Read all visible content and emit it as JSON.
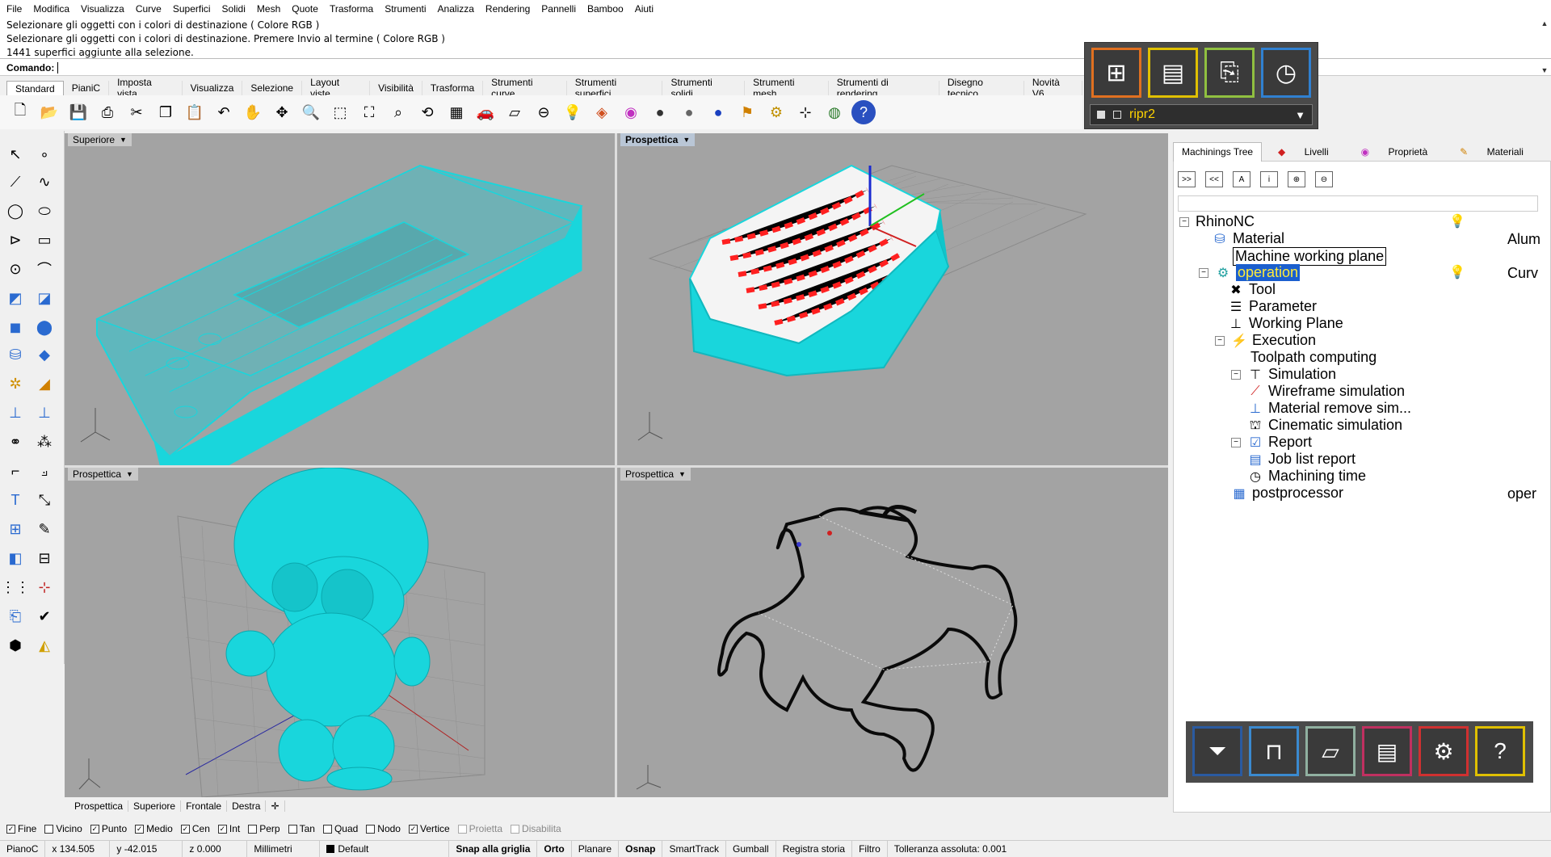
{
  "menu": [
    "File",
    "Modifica",
    "Visualizza",
    "Curve",
    "Superfici",
    "Solidi",
    "Mesh",
    "Quote",
    "Trasforma",
    "Strumenti",
    "Analizza",
    "Rendering",
    "Pannelli",
    "Bamboo",
    "Aiuti"
  ],
  "command_history": [
    "Selezionare gli oggetti con i colori di destinazione ( Colore  RGB )",
    "Selezionare gli oggetti con i colori di destinazione. Premere Invio al termine ( Colore  RGB )",
    "1441 superfici aggiunte alla selezione."
  ],
  "command_prompt": "Comando:",
  "toolbar_tabs": [
    "Standard",
    "PianiC",
    "Imposta vista",
    "Visualizza",
    "Selezione",
    "Layout viste",
    "Visibilità",
    "Trasforma",
    "Strumenti curve",
    "Strumenti superfici",
    "Strumenti solidi",
    "Strumenti mesh",
    "Strumenti di rendering",
    "Disegno tecnico",
    "Novità V6"
  ],
  "toolbar_icons": [
    "new-icon",
    "open-icon",
    "save-icon",
    "print-icon",
    "cut-icon",
    "copy-icon",
    "paste-icon",
    "undo-icon",
    "pan-icon",
    "rotate-icon",
    "zoom-icon",
    "zoom-window-icon",
    "zoom-extents-icon",
    "zoom-selected-icon",
    "rotate-view-icon",
    "grid-icon",
    "car-icon",
    "plane-icon",
    "snap-icon",
    "light-icon",
    "layer-icon",
    "color-icon",
    "sphere-shaded-icon",
    "sphere-render-icon",
    "sphere-blue-icon",
    "flag-icon",
    "gear-icon",
    "dimension-icon",
    "globe-icon",
    "help-icon"
  ],
  "nc_panel": {
    "selected": "ripr2",
    "buttons": [
      "new-operation",
      "machine",
      "import",
      "clock"
    ]
  },
  "viewports": {
    "top_left": "Superiore",
    "top_right": "Prospettica",
    "bottom_left": "Prospettica",
    "bottom_right": "Prospettica"
  },
  "viewport_tabs": [
    "Prospettica",
    "Superiore",
    "Frontale",
    "Destra"
  ],
  "right_panel": {
    "tabs": [
      "Machinings Tree",
      "Livelli",
      "Proprietà",
      "Materiali"
    ],
    "tree_buttons": [
      ">>",
      "<<",
      "A",
      "i",
      "zoom-in",
      "zoom-out"
    ],
    "tree": [
      {
        "label": "RhinoNC",
        "value": ""
      },
      {
        "label": "Material",
        "value": "Alum"
      },
      {
        "label": "Machine working plane",
        "value": ""
      },
      {
        "label": "operation",
        "value": "Curv"
      },
      {
        "label": "Tool",
        "value": ""
      },
      {
        "label": "Parameter",
        "value": ""
      },
      {
        "label": "Working Plane",
        "value": ""
      },
      {
        "label": "Execution",
        "value": ""
      },
      {
        "label": "Toolpath computing",
        "value": ""
      },
      {
        "label": "Simulation",
        "value": ""
      },
      {
        "label": "Wireframe simulation",
        "value": ""
      },
      {
        "label": "Material remove sim...",
        "value": ""
      },
      {
        "label": "Cinematic simulation",
        "value": ""
      },
      {
        "label": "Report",
        "value": ""
      },
      {
        "label": "Job list report",
        "value": ""
      },
      {
        "label": "Machining time",
        "value": ""
      },
      {
        "label": "postprocessor",
        "value": "oper"
      }
    ],
    "bottom_buttons": [
      "tool",
      "machine",
      "stock",
      "cabinet",
      "settings",
      "help"
    ]
  },
  "osnaps": [
    {
      "label": "Fine",
      "checked": true
    },
    {
      "label": "Vicino",
      "checked": false
    },
    {
      "label": "Punto",
      "checked": true
    },
    {
      "label": "Medio",
      "checked": true
    },
    {
      "label": "Cen",
      "checked": true
    },
    {
      "label": "Int",
      "checked": true
    },
    {
      "label": "Perp",
      "checked": false
    },
    {
      "label": "Tan",
      "checked": false
    },
    {
      "label": "Quad",
      "checked": false
    },
    {
      "label": "Nodo",
      "checked": false
    },
    {
      "label": "Vertice",
      "checked": true
    },
    {
      "label": "Proietta",
      "checked": false,
      "disabled": true
    },
    {
      "label": "Disabilita",
      "checked": false,
      "disabled": true
    }
  ],
  "status": {
    "cplane": "PianoC",
    "x": "x 134.505",
    "y": "y -42.015",
    "z": "z 0.000",
    "units": "Millimetri",
    "layer": "Default",
    "items": [
      "Snap alla griglia",
      "Orto",
      "Planare",
      "Osnap",
      "SmartTrack",
      "Gumball",
      "Registra storia",
      "Filtro"
    ],
    "tolerance": "Tolleranza assoluta: 0.001"
  },
  "colors": {
    "viewport_bg": "#a3a3a3",
    "object_cyan": "#19d6dc",
    "toolpath_red": "#ff2020",
    "selection_blue": "#1b5fce"
  }
}
